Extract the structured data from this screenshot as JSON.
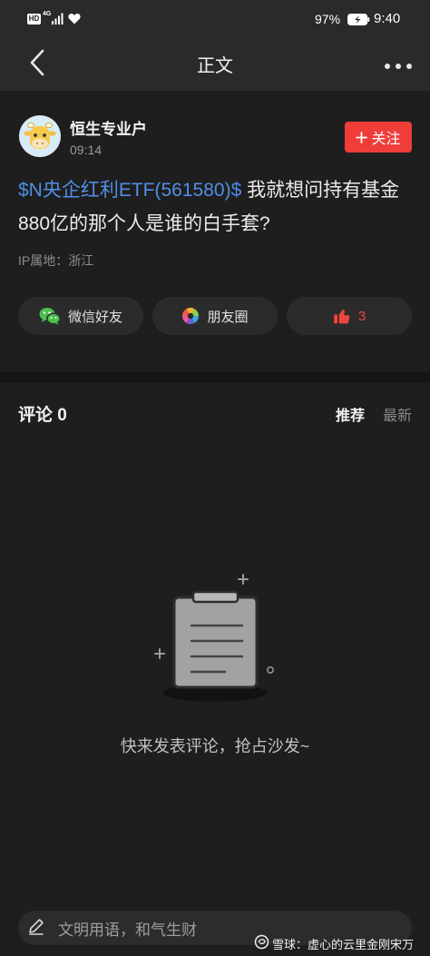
{
  "status_bar": {
    "hd": "HD",
    "network": "4G",
    "battery": "97%",
    "time": "9:40"
  },
  "header": {
    "title": "正文"
  },
  "post": {
    "author": "恒生专业户",
    "time": "09:14",
    "follow_label": "关注",
    "stock_tag": "$N央企红利ETF(561580)$",
    "text": " 我就想问持有基金880亿的那个人是谁的白手套?",
    "ip_location": "IP属地：浙江"
  },
  "share": {
    "wechat_label": "微信好友",
    "moments_label": "朋友圈",
    "like_count": "3"
  },
  "comments": {
    "title": "评论 0",
    "sort_recommended": "推荐",
    "sort_latest": "最新",
    "empty_text": "快来发表评论，抢占沙发~"
  },
  "input": {
    "placeholder": "文明用语，和气生财"
  },
  "watermark": {
    "text": "雪球：虚心的云里金刚宋万"
  },
  "icons": {
    "back": "chevron-left-icon",
    "more": "more-dots-icon",
    "follow": "plus-icon",
    "wechat": "wechat-icon",
    "moments": "moments-icon",
    "like": "thumbs-up-icon",
    "compose": "pencil-icon",
    "watermark_logo": "snowball-logo-icon"
  },
  "colors": {
    "accent_red": "#ef3d3a",
    "stock_link_blue": "#4f8fe8",
    "wechat_green": "#4cc04f",
    "like_red": "#f0443e"
  }
}
